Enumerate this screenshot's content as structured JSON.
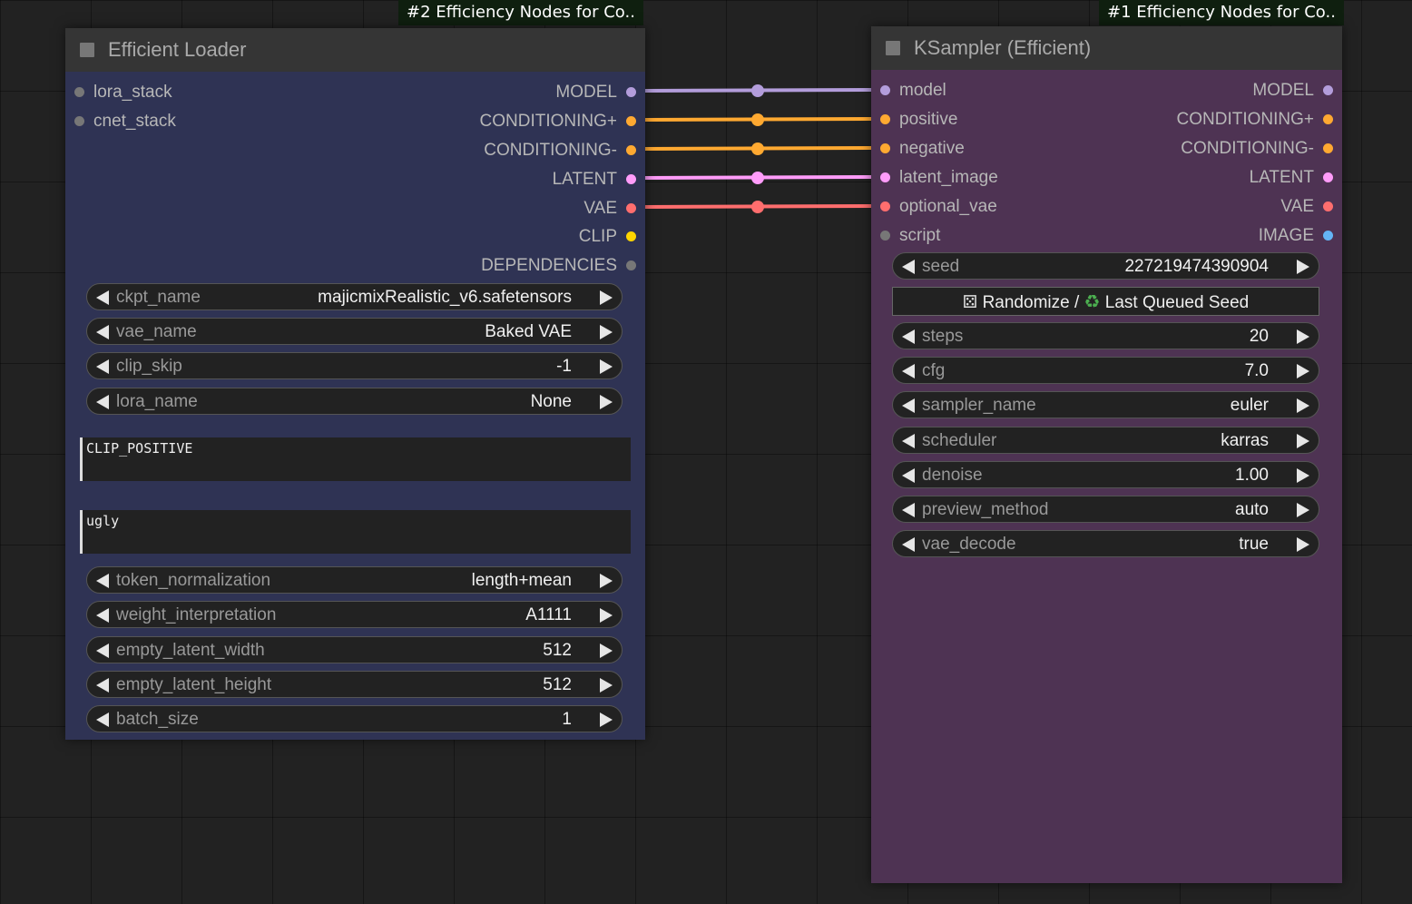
{
  "badges": {
    "loader": "#2 Efficiency Nodes for Co..",
    "sampler": "#1 Efficiency Nodes for Co.."
  },
  "loader": {
    "title": "Efficient Loader",
    "inputs": [
      "lora_stack",
      "cnet_stack"
    ],
    "outputs": [
      "MODEL",
      "CONDITIONING+",
      "CONDITIONING-",
      "LATENT",
      "VAE",
      "CLIP",
      "DEPENDENCIES"
    ],
    "widgets": [
      {
        "name": "ckpt_name",
        "value": "majicmixRealistic_v6.safetensors"
      },
      {
        "name": "vae_name",
        "value": "Baked VAE"
      },
      {
        "name": "clip_skip",
        "value": "-1"
      },
      {
        "name": "lora_name",
        "value": "None"
      }
    ],
    "positive_text": "CLIP_POSITIVE",
    "negative_text": "ugly",
    "widgets2": [
      {
        "name": "token_normalization",
        "value": "length+mean"
      },
      {
        "name": "weight_interpretation",
        "value": "A1111"
      },
      {
        "name": "empty_latent_width",
        "value": "512"
      },
      {
        "name": "empty_latent_height",
        "value": "512"
      },
      {
        "name": "batch_size",
        "value": "1"
      }
    ]
  },
  "sampler": {
    "title": "KSampler (Efficient)",
    "inputs": [
      "model",
      "positive",
      "negative",
      "latent_image",
      "optional_vae",
      "script"
    ],
    "outputs": [
      "MODEL",
      "CONDITIONING+",
      "CONDITIONING-",
      "LATENT",
      "VAE",
      "IMAGE"
    ],
    "seed": {
      "name": "seed",
      "value": "227219474390904"
    },
    "seed_button": {
      "dice_icon": "dice-icon",
      "recycle_icon": "recycle-icon",
      "randomize_label": "Randomize /",
      "last_label": "Last Queued Seed"
    },
    "widgets": [
      {
        "name": "steps",
        "value": "20"
      },
      {
        "name": "cfg",
        "value": "7.0"
      },
      {
        "name": "sampler_name",
        "value": "euler"
      },
      {
        "name": "scheduler",
        "value": "karras"
      },
      {
        "name": "denoise",
        "value": "1.00"
      },
      {
        "name": "preview_method",
        "value": "auto"
      },
      {
        "name": "vae_decode",
        "value": "true"
      }
    ]
  },
  "colors": {
    "model": "#b39ddb",
    "conditioning": "#ffa931",
    "latent": "#ff9cf9",
    "vae": "#ff6e6e",
    "clip": "#ffd500",
    "image": "#64b5f6",
    "unconnected": "#777777",
    "loader_bg": "#335",
    "sampler_bg": "#533"
  }
}
